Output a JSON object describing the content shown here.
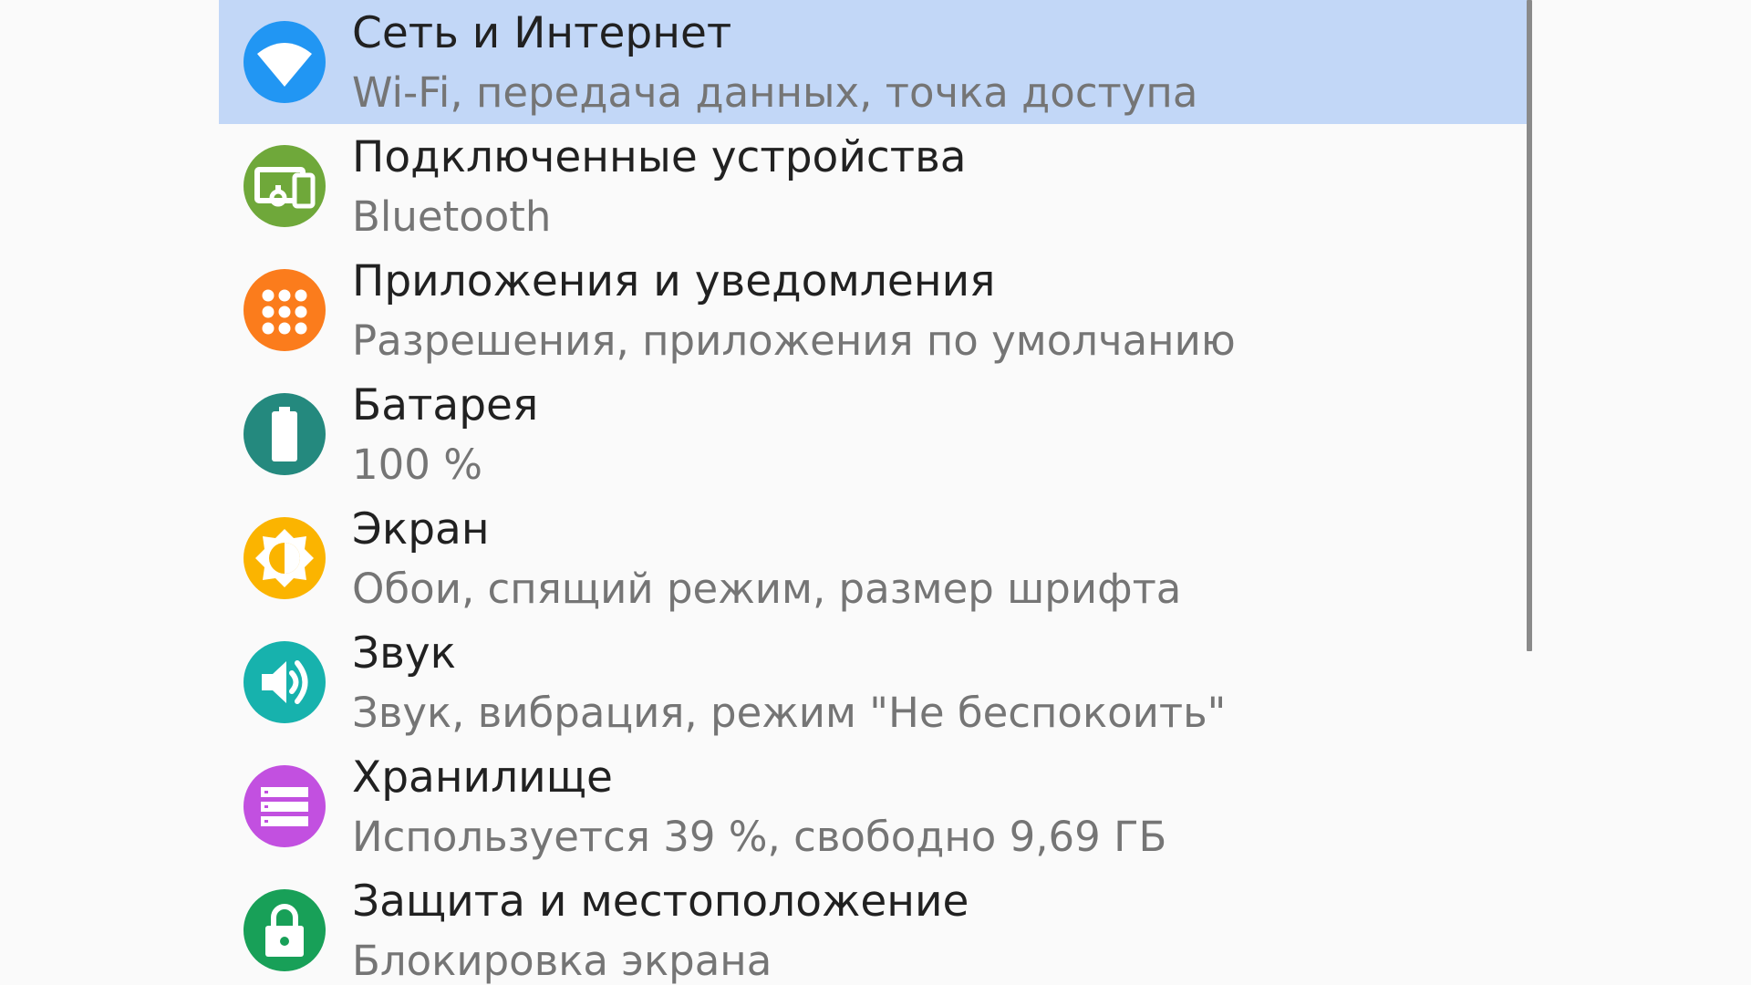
{
  "settings": {
    "items": [
      {
        "title": "Сеть и Интернет",
        "subtitle": "Wi-Fi, передача данных, точка доступа",
        "icon": "wifi-icon",
        "color": "#2196f3",
        "selected": true
      },
      {
        "title": "Подключенные устройства",
        "subtitle": "Bluetooth",
        "icon": "connected-devices-icon",
        "color": "#6fa83a"
      },
      {
        "title": "Приложения и уведомления",
        "subtitle": "Разрешения, приложения по умолчанию",
        "icon": "apps-grid-icon",
        "color": "#fb7c1c"
      },
      {
        "title": "Батарея",
        "subtitle": "100 %",
        "icon": "battery-icon",
        "color": "#24897e"
      },
      {
        "title": "Экран",
        "subtitle": "Обои, спящий режим, размер шрифта",
        "icon": "brightness-icon",
        "color": "#fbb400"
      },
      {
        "title": "Звук",
        "subtitle": "Звук, вибрация, режим \"Не беспокоить\"",
        "icon": "volume-icon",
        "color": "#17b2ad"
      },
      {
        "title": "Хранилище",
        "subtitle": "Используется 39 %, свободно 9,69 ГБ",
        "icon": "storage-icon",
        "color": "#c250e0"
      },
      {
        "title": "Защита и местоположение",
        "subtitle": "Блокировка экрана",
        "icon": "lock-icon",
        "color": "#18a058"
      }
    ]
  }
}
